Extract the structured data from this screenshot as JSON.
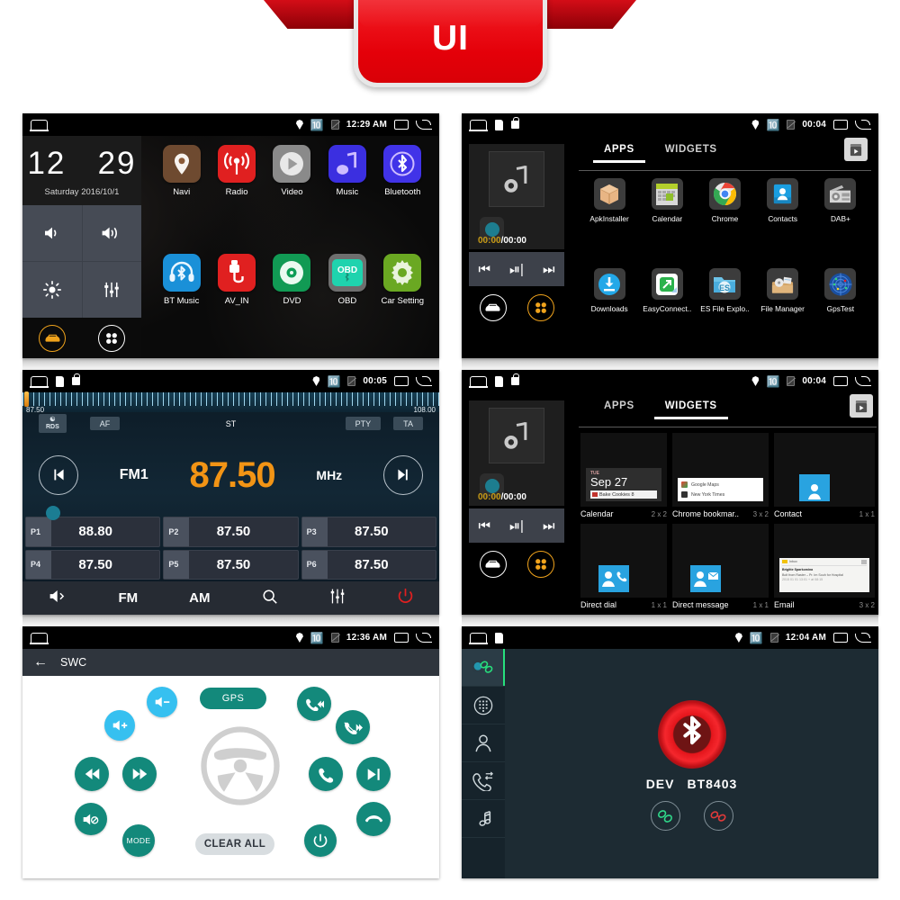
{
  "banner": {
    "text": "UI",
    "color": "#e40009"
  },
  "panels": {
    "home": {
      "statusbar": {
        "time": "12:29 AM"
      },
      "clock": {
        "hour": "12",
        "minute": "29",
        "date": "Saturday 2016/10/1",
        "buttons": [
          "volume-down-icon",
          "volume-up-icon",
          "brightness-icon",
          "equalizer-icon"
        ],
        "tabs": [
          "car-icon",
          "apps-dots-icon"
        ]
      },
      "apps": [
        {
          "label": "Navi",
          "icon": "map-pin-icon",
          "color": "#6e4a30"
        },
        {
          "label": "Radio",
          "icon": "radio-waves-icon",
          "color": "#e02020"
        },
        {
          "label": "Video",
          "icon": "play-circle-icon",
          "color": "#8a8a8a"
        },
        {
          "label": "Music",
          "icon": "music-note-icon",
          "color": "#3b2fe0"
        },
        {
          "label": "Bluetooth",
          "icon": "bluetooth-icon",
          "color": "#4133e8"
        },
        {
          "label": "BT Music",
          "icon": "bt-headset-icon",
          "color": "#1a90d8"
        },
        {
          "label": "AV_IN",
          "icon": "av-plug-icon",
          "color": "#e02020"
        },
        {
          "label": "DVD",
          "icon": "disc-icon",
          "color": "#119a54"
        },
        {
          "label": "OBD",
          "icon": "obd-icon",
          "color": "#6e6e6e"
        },
        {
          "label": "Car Setting",
          "icon": "gear-icon",
          "color": "#6aa822"
        }
      ]
    },
    "apps": {
      "statusbar": {
        "time": "00:04"
      },
      "player": {
        "elapsed": "00:00",
        "total": "00:00",
        "separator": "/",
        "controls": [
          "prev-icon",
          "play-pause-icon",
          "next-icon"
        ],
        "tabs": [
          "car-icon",
          "apps-dots-icon"
        ]
      },
      "tabs": [
        {
          "label": "APPS",
          "active": true
        },
        {
          "label": "WIDGETS",
          "active": false
        }
      ],
      "play_store_icon": "play-store-icon",
      "items": [
        {
          "label": "ApkInstaller",
          "icon": "package-box-icon"
        },
        {
          "label": "Calendar",
          "icon": "calendar-icon"
        },
        {
          "label": "Chrome",
          "icon": "chrome-icon"
        },
        {
          "label": "Contacts",
          "icon": "contacts-icon"
        },
        {
          "label": "DAB+",
          "icon": "dab-radio-icon"
        },
        {
          "label": "Downloads",
          "icon": "download-icon"
        },
        {
          "label": "EasyConnect..",
          "icon": "easyconnect-icon"
        },
        {
          "label": "ES File Explo..",
          "icon": "es-file-explorer-icon"
        },
        {
          "label": "File Manager",
          "icon": "file-manager-icon"
        },
        {
          "label": "GpsTest",
          "icon": "gps-radar-icon"
        }
      ]
    },
    "radio": {
      "statusbar": {
        "time": "00:05"
      },
      "tuner": {
        "min": "87.50",
        "max": "108.00"
      },
      "rds": {
        "rds_label": "RDS",
        "af": "AF",
        "st": "ST",
        "pty": "PTY",
        "ta": "TA"
      },
      "band": "FM1",
      "frequency": "87.50",
      "unit": "MHz",
      "prev_icon": "seek-prev-icon",
      "next_icon": "seek-next-icon",
      "presets": [
        {
          "no": "P1",
          "value": "88.80"
        },
        {
          "no": "P2",
          "value": "87.50"
        },
        {
          "no": "P3",
          "value": "87.50"
        },
        {
          "no": "P4",
          "value": "87.50"
        },
        {
          "no": "P5",
          "value": "87.50"
        },
        {
          "no": "P6",
          "value": "87.50"
        }
      ],
      "bottombar": [
        {
          "label": "",
          "icon": "mute-icon"
        },
        {
          "label": "FM",
          "icon": ""
        },
        {
          "label": "AM",
          "icon": ""
        },
        {
          "label": "",
          "icon": "search-icon"
        },
        {
          "label": "",
          "icon": "equalizer-icon"
        },
        {
          "label": "",
          "icon": "power-icon"
        }
      ]
    },
    "widgets": {
      "statusbar": {
        "time": "00:04"
      },
      "player": {
        "elapsed": "00:00",
        "total": "00:00",
        "separator": "/"
      },
      "tabs": [
        {
          "label": "APPS",
          "active": false
        },
        {
          "label": "WIDGETS",
          "active": true
        }
      ],
      "items": [
        {
          "label": "Calendar",
          "size": "2 x 2",
          "preview": "calendar-widget",
          "preview_text": {
            "dow": "TUE",
            "date": "Sep 27",
            "event": "Bake Cookies"
          }
        },
        {
          "label": "Chrome bookmar..",
          "size": "3 x 2",
          "preview": "chrome-bookmarks-widget",
          "preview_text": {
            "line1": "Google Maps",
            "line2": "New York Times"
          }
        },
        {
          "label": "Contact",
          "size": "1 x 1",
          "preview": "contact-widget"
        },
        {
          "label": "Direct dial",
          "size": "1 x 1",
          "preview": "direct-dial-widget"
        },
        {
          "label": "Direct message",
          "size": "1 x 1",
          "preview": "direct-message-widget"
        },
        {
          "label": "Email",
          "size": "3 x 2",
          "preview": "email-widget"
        }
      ]
    },
    "swc": {
      "statusbar": {
        "time": "12:36 AM"
      },
      "title": "SWC",
      "back_icon": "arrow-back-icon",
      "wheel_icon": "steering-wheel-icon",
      "labels": {
        "gps": "GPS",
        "clear_all": "CLEAR ALL",
        "mode": "MODE"
      },
      "buttons": [
        {
          "name": "vol-down",
          "icon": "volume-down-icon",
          "color": "#36c0f0"
        },
        {
          "name": "vol-up",
          "icon": "volume-up-icon",
          "color": "#36c0f0"
        },
        {
          "name": "prev-track",
          "icon": "prev-track-icon",
          "color": "#13897b"
        },
        {
          "name": "next-track",
          "icon": "next-track-icon",
          "color": "#13897b"
        },
        {
          "name": "mute",
          "icon": "mute-icon",
          "color": "#13897b"
        },
        {
          "name": "mode",
          "icon": "mode-text",
          "color": "#13897b"
        },
        {
          "name": "call-prev",
          "icon": "call-prev-icon",
          "color": "#13897b"
        },
        {
          "name": "call-next",
          "icon": "call-next-icon",
          "color": "#13897b"
        },
        {
          "name": "answer-call",
          "icon": "phone-answer-icon",
          "color": "#13897b"
        },
        {
          "name": "play-pause",
          "icon": "play-pause-icon",
          "color": "#13897b"
        },
        {
          "name": "end-call",
          "icon": "phone-hangup-icon",
          "color": "#13897b"
        },
        {
          "name": "power",
          "icon": "power-icon",
          "color": "#13897b"
        }
      ]
    },
    "bluetooth": {
      "statusbar": {
        "time": "12:04 AM"
      },
      "sidebar": [
        {
          "icon": "bt-link-icon",
          "active": true
        },
        {
          "icon": "dialpad-icon",
          "active": false
        },
        {
          "icon": "person-icon",
          "active": false
        },
        {
          "icon": "call-log-icon",
          "active": false
        },
        {
          "icon": "music-note-icon",
          "active": false
        }
      ],
      "center_icon": "bluetooth-icon",
      "dev_label": "DEV",
      "device_name": "BT8403",
      "actions": [
        {
          "icon": "connect-icon",
          "color": "#2fd98a"
        },
        {
          "icon": "disconnect-icon",
          "color": "#e03a3a"
        }
      ]
    }
  }
}
